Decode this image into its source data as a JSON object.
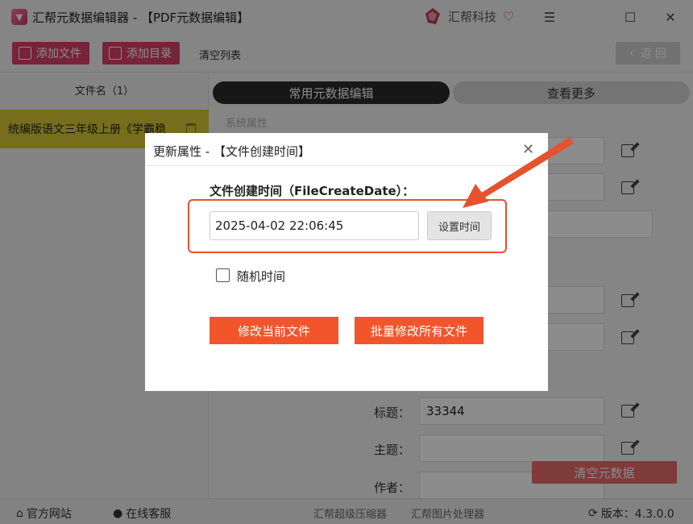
{
  "titlebar": {
    "title": "汇帮元数据编辑器 - 【PDF元数据编辑】",
    "brand": "汇帮科技"
  },
  "toolbar": {
    "add_file": "添加文件",
    "add_folder": "添加目录",
    "clear_list": "清空列表",
    "back": "返 回"
  },
  "left_panel": {
    "header": "文件名（1）",
    "files": [
      "统编版语文三年级上册《学霸稳"
    ]
  },
  "right_panel": {
    "tab_active": "常用元数据编辑",
    "tab_more": "查看更多",
    "section_label": "系统属性",
    "title_label": "标题：",
    "title_value": "33344",
    "subject_label": "主题：",
    "author_label": "作者：",
    "clear_button": "清空元数据"
  },
  "modal": {
    "title": "更新属性 - 【文件创建时间】",
    "field_label": "文件创建时间（FileCreateDate）：",
    "date_value": "2025-04-02 22:06:45",
    "set_time": "设置时间",
    "random_time": "随机时间",
    "modify_current": "修改当前文件",
    "modify_all": "批量修改所有文件"
  },
  "footer": {
    "website": "官方网站",
    "support": "在线客服",
    "compressor": "汇帮超级压缩器",
    "image_tool": "汇帮图片处理器",
    "version": "版本：4.3.0.0"
  },
  "colors": {
    "accent": "#d9416a",
    "modal_button": "#f2552c",
    "highlight": "#e5522e"
  }
}
